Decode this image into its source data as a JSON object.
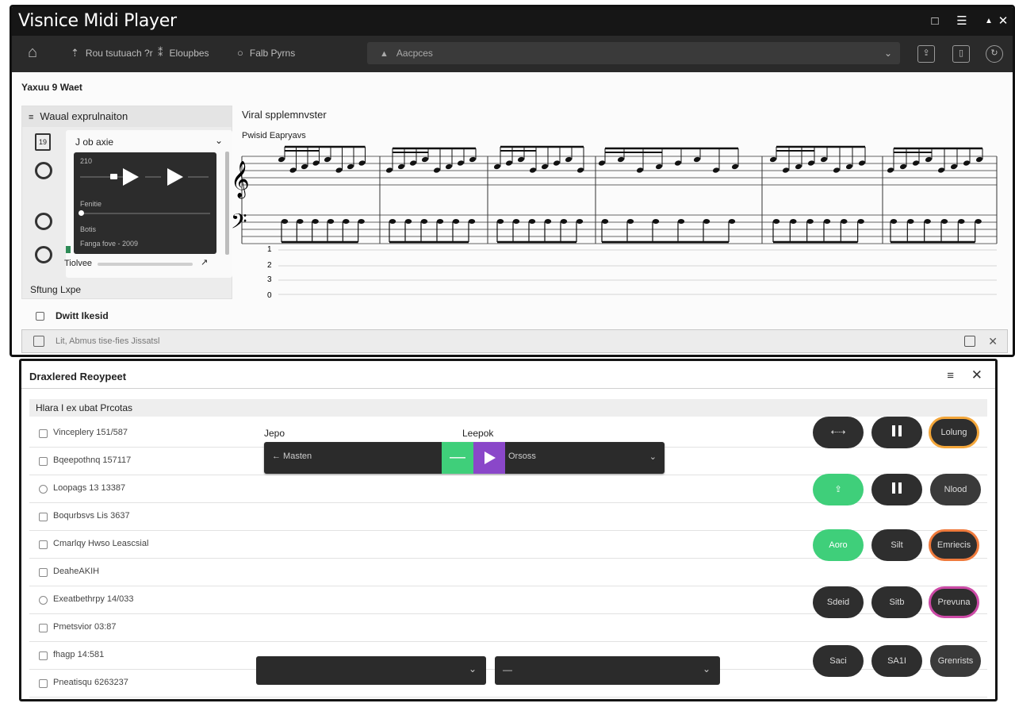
{
  "app": {
    "title": "Visnice Midi Player"
  },
  "titlebar": {
    "icon1": "□",
    "icon2": "☰",
    "icon3": "▲",
    "close": "✕"
  },
  "toolbar": {
    "home_icon": "⌂",
    "item1_icon": "⇡",
    "item1": "Rou tsutuach ?r",
    "item2_icon": "⁑",
    "item2": "Eloupbes",
    "item3_icon": "○",
    "item3": "Falb Pyrns",
    "address": "Aacpces",
    "address_icon": "▲",
    "address_chevron": "⌄"
  },
  "document": {
    "title": "Yaxuu 9 Waet"
  },
  "sidebar": {
    "header": "Waual exprulnaiton",
    "header_icon": "≡",
    "card_label": "J ob axie",
    "card_chevron": "⌄",
    "player": {
      "time": "210",
      "section": "Fenitie",
      "detail": "Botis",
      "stamp": "Fanga fove - 2009"
    },
    "volume_label": "Tiolvee",
    "volume_level": 0.95,
    "volume_arrow": "↗",
    "footer": "Sftung Lxpe"
  },
  "checkbox_row": {
    "label": "Dwitt Ikesid"
  },
  "score": {
    "title": "Viral spplemnvster",
    "subtitle": "Pwisid Eapryavs",
    "line_numbers": [
      "1",
      "2",
      "3",
      "0"
    ]
  },
  "statusbar": {
    "text": "Lit, Abmus tise-fies Jissatsl",
    "close": "✕"
  },
  "dialog": {
    "title": "Draxlered Reoypeet",
    "menu": "≡",
    "close": "✕",
    "list_header": "Hlara I ex ubat Prcotas",
    "rows": [
      {
        "label": "Vinceplery 151/587"
      },
      {
        "label": "Bqeepothnq 157117"
      },
      {
        "label": "Loopags 13 13387"
      },
      {
        "label": "Boqurbsvs Lis 3637"
      },
      {
        "label": "Cmarlqy Hwso Leascsial"
      },
      {
        "label": "DeaheAKIH"
      },
      {
        "label": "Exeatbethrpy 14/033"
      },
      {
        "label": "Pmetsvior 03:87"
      },
      {
        "label": "fhagp 14:581"
      },
      {
        "label": "Pneatisqu 6263237"
      }
    ],
    "tempo_label": "Jepo",
    "loop_label": "Leepok",
    "transport": {
      "back": "← Masten",
      "green_label": "—",
      "select": "Orsoss",
      "chevron": "⌄"
    },
    "buttons": {
      "r1": [
        "⇠⇢",
        "",
        "Lolung"
      ],
      "r2": [
        "⇪",
        "",
        "Nlood"
      ],
      "r3": [
        "Aoro",
        "Silt",
        "Emriecis"
      ],
      "r4": [
        "Sdeid",
        "Sitb",
        "Prevuna"
      ],
      "r5": [
        "Saci",
        "SA1I",
        "Grenrists"
      ]
    },
    "dropdown1": {
      "value": "",
      "chevron": "⌄"
    },
    "dropdown2": {
      "value": "—",
      "chevron": "⌄"
    }
  }
}
